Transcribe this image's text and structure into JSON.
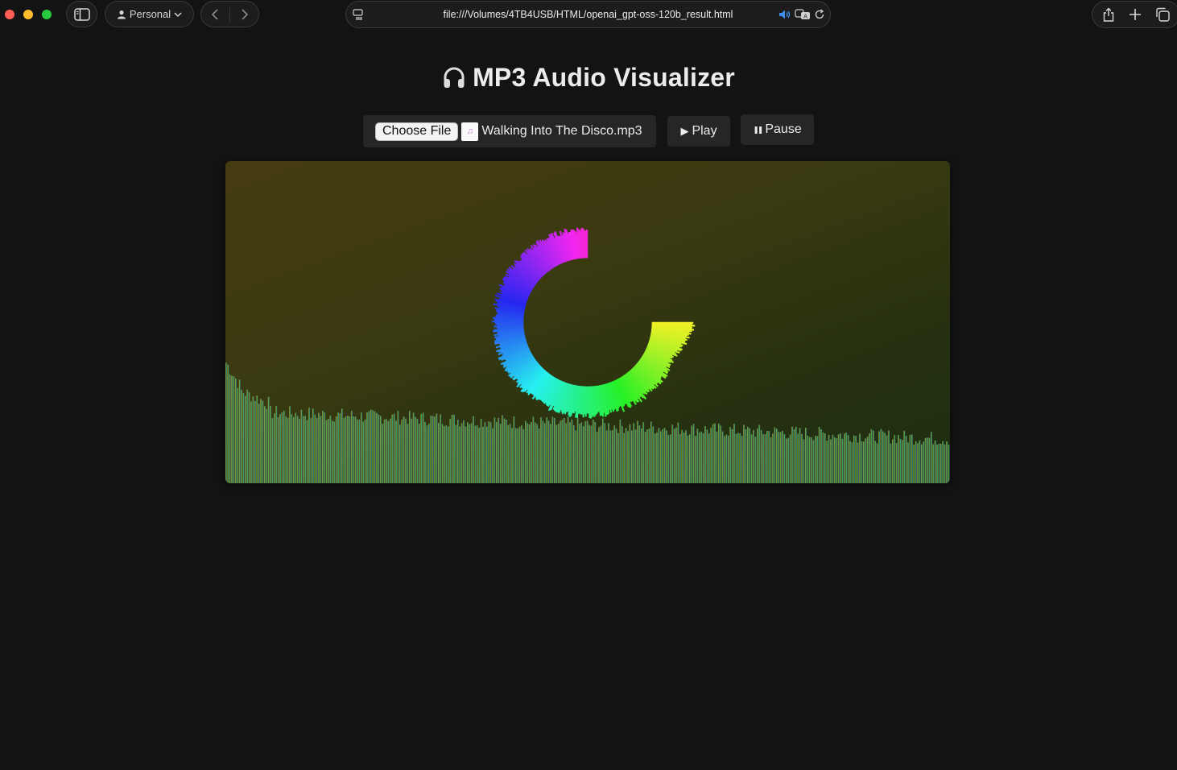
{
  "browser": {
    "profile_label": "Personal",
    "url": "file:///Volumes/4TB4USB/HTML/openai_gpt-oss-120b_result.html"
  },
  "page": {
    "title": "MP3 Audio Visualizer",
    "title_emoji": "🎧"
  },
  "controls": {
    "choose_file_label": "Choose File",
    "file_name": "Walking Into The Disco.mp3",
    "play_label": "Play",
    "play_icon": "▶",
    "pause_label": "Pause",
    "pause_icon": "❚❚"
  },
  "visualizer": {
    "ring_sweep_degrees": 270,
    "ring_start_angle_degrees": 0,
    "colors": {
      "background_start": "#453b10",
      "background_end": "#1e2e10",
      "bars_left": "#d4a03a",
      "bars_mid": "#46b84a",
      "bars_right": "#3a5aa8"
    }
  }
}
